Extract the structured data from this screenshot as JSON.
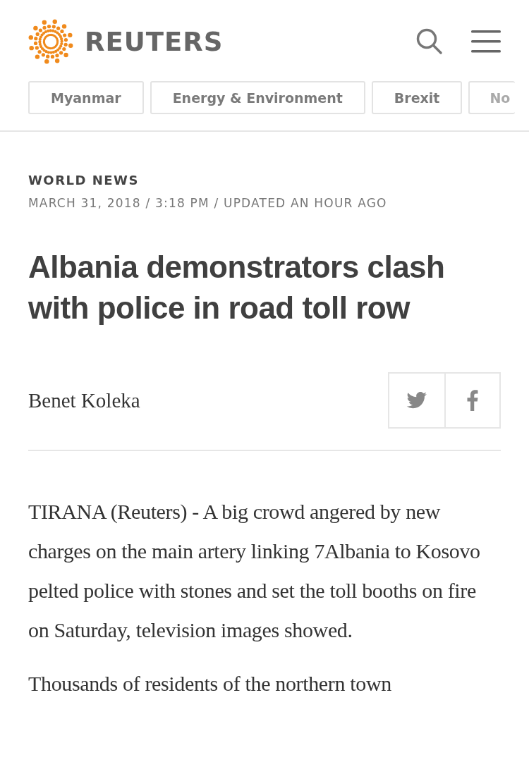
{
  "header": {
    "brand": "REUTERS"
  },
  "topics": [
    {
      "label": "Myanmar",
      "faded": false
    },
    {
      "label": "Energy & Environment",
      "faded": false
    },
    {
      "label": "Brexit",
      "faded": false
    },
    {
      "label": "No",
      "faded": true
    }
  ],
  "article": {
    "section": "WORLD NEWS",
    "dateline": "MARCH 31, 2018 / 3:18 PM / UPDATED AN HOUR AGO",
    "headline": "Albania demonstrators clash with police in road toll row",
    "byline": "Benet Koleka",
    "paragraphs": [
      "TIRANA (Reuters) - A big crowd angered by new charges on the main artery linking 7Albania to Kosovo pelted police with stones and set the toll booths on fire on Saturday, television images showed.",
      "Thousands of residents of the northern town"
    ]
  }
}
